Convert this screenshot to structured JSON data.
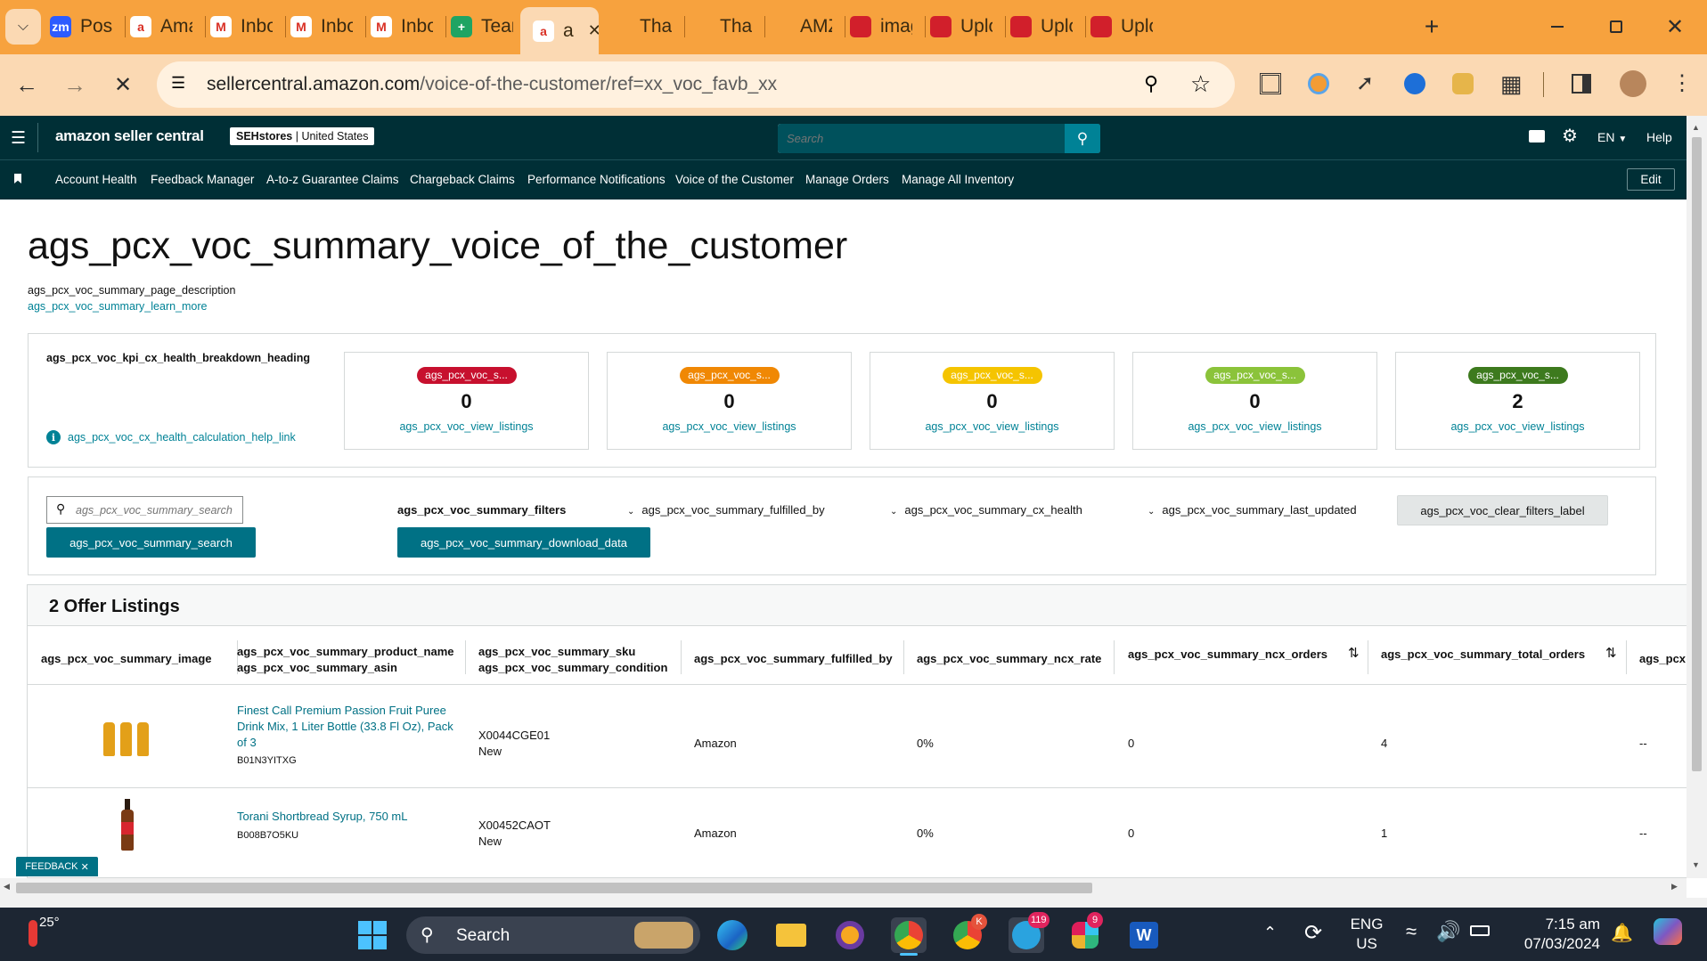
{
  "browser": {
    "tabs": [
      {
        "label": "Post",
        "fav_color": "#2d5bff",
        "fav_text": "zm"
      },
      {
        "label": "Ama",
        "fav_color": "#ffffff",
        "fav_text": "a"
      },
      {
        "label": "Inbo",
        "fav_color": "#ffffff",
        "fav_text": "M"
      },
      {
        "label": "Inbo",
        "fav_color": "#ffffff",
        "fav_text": "M"
      },
      {
        "label": "Inbo",
        "fav_color": "#ffffff",
        "fav_text": "M"
      },
      {
        "label": "Team",
        "fav_color": "#1fa463",
        "fav_text": "+"
      },
      {
        "label": "a",
        "fav_color": "#ffffff",
        "fav_text": "a"
      },
      {
        "label": "Than",
        "fav_color": "#f7a23e",
        "fav_text": ""
      },
      {
        "label": "Than",
        "fav_color": "#f7a23e",
        "fav_text": ""
      },
      {
        "label": "AMZ",
        "fav_color": "#f7a23e",
        "fav_text": ""
      },
      {
        "label": "imag",
        "fav_color": "#d11f2b",
        "fav_text": ""
      },
      {
        "label": "Uplo",
        "fav_color": "#d11f2b",
        "fav_text": ""
      },
      {
        "label": "Uplo",
        "fav_color": "#d11f2b",
        "fav_text": ""
      },
      {
        "label": "Uplo",
        "fav_color": "#d11f2b",
        "fav_text": ""
      }
    ],
    "url_host": "sellercentral.amazon.com",
    "url_path": "/voice-of-the-customer/ref=xx_voc_favb_xx"
  },
  "header": {
    "logo": "amazon seller central",
    "store_name": "SEHstores",
    "store_region": "United States",
    "search_placeholder": "Search",
    "language": "EN",
    "help": "Help"
  },
  "nav": {
    "items": [
      "Account Health",
      "Feedback Manager",
      "A-to-z Guarantee Claims",
      "Chargeback Claims",
      "Performance Notifications",
      "Voice of the Customer",
      "Manage Orders",
      "Manage All Inventory"
    ],
    "edit": "Edit"
  },
  "page": {
    "title": "ags_pcx_voc_summary_voice_of_the_customer",
    "description": "ags_pcx_voc_summary_page_description",
    "learn_more": "ags_pcx_voc_summary_learn_more"
  },
  "kpi": {
    "heading": "ags_pcx_voc_kpi_cx_health_breakdown_heading",
    "help_link": "ags_pcx_voc_cx_health_calculation_help_link",
    "cards": [
      {
        "badge": "ags_pcx_voc_s...",
        "badge_color": "#c7102e",
        "value": "0",
        "link": "ags_pcx_voc_view_listings"
      },
      {
        "badge": "ags_pcx_voc_s...",
        "badge_color": "#f08804",
        "value": "0",
        "link": "ags_pcx_voc_view_listings"
      },
      {
        "badge": "ags_pcx_voc_s...",
        "badge_color": "#f5c400",
        "value": "0",
        "link": "ags_pcx_voc_view_listings"
      },
      {
        "badge": "ags_pcx_voc_s...",
        "badge_color": "#8bc33a",
        "value": "0",
        "link": "ags_pcx_voc_view_listings"
      },
      {
        "badge": "ags_pcx_voc_s...",
        "badge_color": "#3d7a1e",
        "value": "2",
        "link": "ags_pcx_voc_view_listings"
      }
    ]
  },
  "filters": {
    "search_placeholder": "ags_pcx_voc_summary_search",
    "search_button": "ags_pcx_voc_summary_search",
    "filters_label": "ags_pcx_voc_summary_filters",
    "download_button": "ags_pcx_voc_summary_download_data",
    "fulfilled_by": "ags_pcx_voc_summary_fulfilled_by",
    "cx_health": "ags_pcx_voc_summary_cx_health",
    "last_updated": "ags_pcx_voc_summary_last_updated",
    "clear": "ags_pcx_voc_clear_filters_label"
  },
  "table": {
    "title": "2 Offer Listings",
    "columns": {
      "image": "ags_pcx_voc_summary_image",
      "product_name": "ags_pcx_voc_summary_product_name",
      "asin": "ags_pcx_voc_summary_asin",
      "sku": "ags_pcx_voc_summary_sku",
      "condition": "ags_pcx_voc_summary_condition",
      "fulfilled_by": "ags_pcx_voc_summary_fulfilled_by",
      "ncx_rate": "ags_pcx_voc_summary_ncx_rate",
      "ncx_orders": "ags_pcx_voc_summary_ncx_orders",
      "total_orders": "ags_pcx_voc_summary_total_orders",
      "more": "ags_pcx"
    },
    "rows": [
      {
        "product": "Finest Call Premium Passion Fruit Puree Drink Mix, 1 Liter Bottle (33.8 Fl Oz), Pack of 3",
        "asin": "B01N3YITXG",
        "sku": "X0044CGE01",
        "condition": "New",
        "fulfilled_by": "Amazon",
        "ncx_rate": "0%",
        "ncx_orders": "0",
        "total_orders": "4",
        "more": "--"
      },
      {
        "product": "Torani Shortbread Syrup, 750 mL",
        "asin": "B008B7O5KU",
        "sku": "X00452CAOT",
        "condition": "New",
        "fulfilled_by": "Amazon",
        "ncx_rate": "0%",
        "ncx_orders": "0",
        "total_orders": "1",
        "more": "--"
      }
    ]
  },
  "feedback": "FEEDBACK",
  "taskbar": {
    "temperature": "25°",
    "search": "Search",
    "telegram_badge": "119",
    "chrome2_badge": "K",
    "slack_badge": "9",
    "lang_line1": "ENG",
    "lang_line2": "US",
    "time": "7:15 am",
    "date": "07/03/2024"
  }
}
